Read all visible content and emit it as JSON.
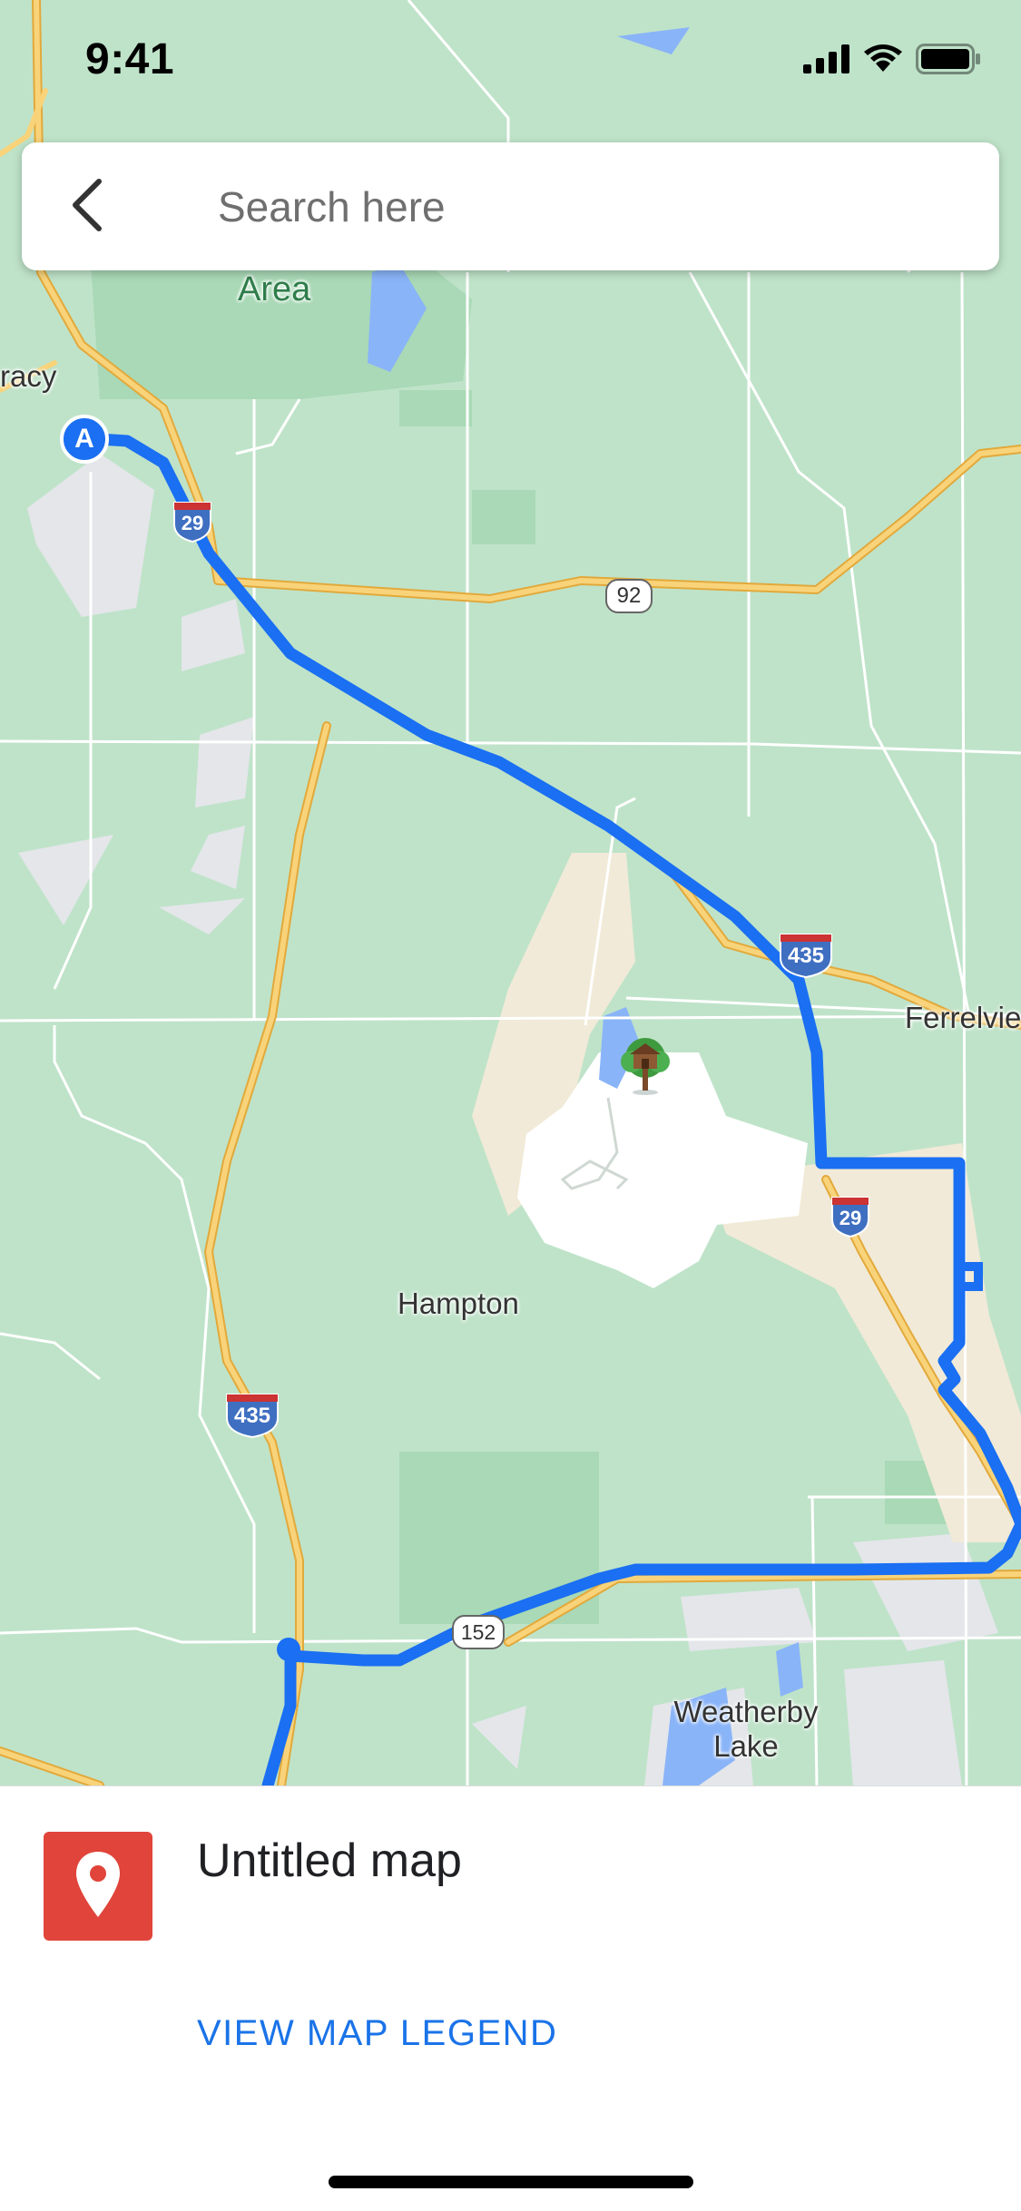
{
  "status_bar": {
    "time": "9:41",
    "icons": [
      "signal-icon",
      "wifi-icon",
      "battery-icon"
    ]
  },
  "search": {
    "placeholder": "Search here",
    "back_icon": "chevron-left-icon"
  },
  "map": {
    "place_labels": {
      "area": "Area",
      "tracy": "racy",
      "ferrelview": "Ferrelvie",
      "hampton": "Hampton",
      "weatherby_lake": "Weatherby Lake"
    },
    "shields": {
      "i29_north": "29",
      "i29_south": "29",
      "i435_east": "435",
      "i435_west": "435",
      "route_92": "92",
      "route_152": "152"
    },
    "start_marker": "A",
    "poi_icon": "treehouse-icon",
    "colors": {
      "water": "#8ab4f8",
      "park": "#a8dab5",
      "land": "#bfe3c9",
      "route": "#1a6ff2",
      "highway": "#f8c55a",
      "urban": "#e4e6ea",
      "beige": "#f1ead8"
    }
  },
  "bottom_sheet": {
    "title": "Untitled map",
    "legend_link": "VIEW MAP LEGEND",
    "icon": "map-pin-icon",
    "icon_color": "#e0443a"
  }
}
